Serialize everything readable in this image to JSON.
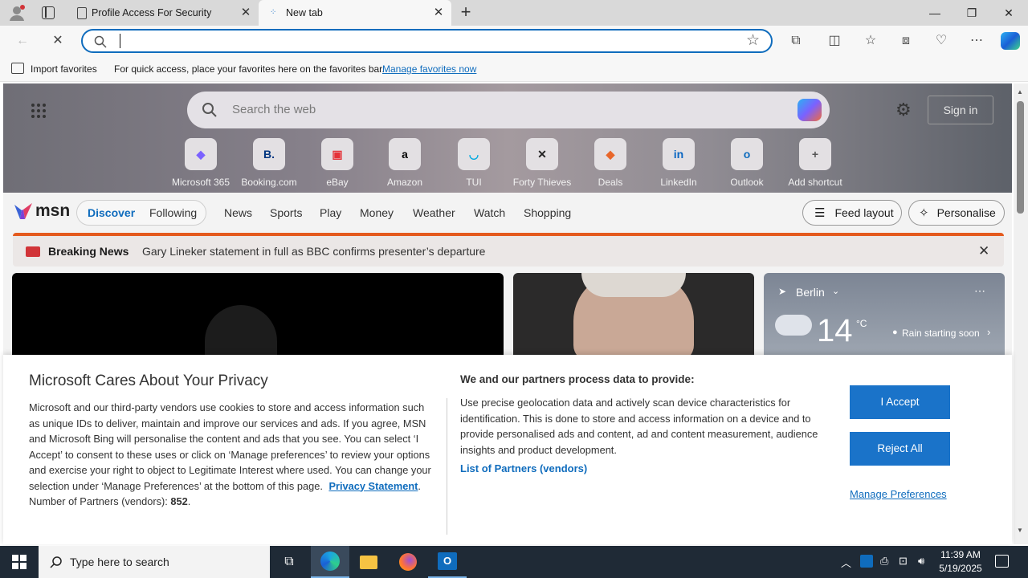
{
  "browser": {
    "tabs": [
      {
        "label": "Profile Access For Security",
        "active": false
      },
      {
        "label": "New tab",
        "active": true
      }
    ],
    "address_value": "",
    "favorites_bar": {
      "import_label": "Import favorites",
      "hint": "For quick access, place your favorites here on the favorites bar.",
      "manage_link": "Manage favorites now"
    }
  },
  "newtab": {
    "search_placeholder": "Search the web",
    "sign_in": "Sign in",
    "shortcuts": [
      {
        "label": "Microsoft 365",
        "glyph": "◆",
        "color": "#7b61ff"
      },
      {
        "label": "Booking.com",
        "glyph": "B.",
        "color": "#003580"
      },
      {
        "label": "eBay",
        "glyph": "▣",
        "color": "#e53238"
      },
      {
        "label": "Amazon",
        "glyph": "a",
        "color": "#000000"
      },
      {
        "label": "TUI",
        "glyph": "◡",
        "color": "#00a9e0"
      },
      {
        "label": "Forty Thieves",
        "glyph": "✕",
        "color": "#222222"
      },
      {
        "label": "Deals",
        "glyph": "◆",
        "color": "#e8662a"
      },
      {
        "label": "LinkedIn",
        "glyph": "in",
        "color": "#0a66c2"
      },
      {
        "label": "Outlook",
        "glyph": "o",
        "color": "#0f6cbd"
      },
      {
        "label": "Add shortcut",
        "glyph": "+",
        "color": "#555555"
      }
    ],
    "brand": "msn",
    "nav": {
      "discover": "Discover",
      "following": "Following",
      "items": [
        "News",
        "Sports",
        "Play",
        "Money",
        "Weather",
        "Watch",
        "Shopping"
      ],
      "feed_layout": "Feed layout",
      "personalise": "Personalise"
    },
    "breaking": {
      "label": "Breaking News",
      "headline": "Gary Lineker statement in full as BBC confirms presenter’s departure"
    },
    "weather": {
      "city": "Berlin",
      "temp": "14",
      "unit": "°C",
      "forecast": "Rain starting soon"
    }
  },
  "privacy": {
    "title": "Microsoft Cares About Your Privacy",
    "body": "Microsoft and our third-party vendors use cookies to store and access information such as unique IDs to deliver, maintain and improve our services and ads. If you agree, MSN and Microsoft Bing will personalise the content and ads that you see. You can select ‘I Accept’ to consent to these uses or click on ‘Manage preferences’ to review your options and exercise your right to object to Legitimate Interest where used.  You can change your selection under ‘Manage Preferences’ at the bottom of this page.",
    "privacy_link": "Privacy Statement",
    "partners_label": "Number of Partners (vendors):",
    "partners_count": "852",
    "right_title": "We and our partners process data to provide:",
    "right_body": "Use precise geolocation data and actively scan device characteristics for identification. This is done to store and access information on a device and to provide personalised ads and content, ad and content measurement, audience insights and product development.",
    "partners_link": "List of Partners (vendors)",
    "accept": "I Accept",
    "reject": "Reject All",
    "manage": "Manage Preferences"
  },
  "taskbar": {
    "search_placeholder": "Type here to search",
    "time": "11:39 AM",
    "date": "5/19/2025"
  },
  "colors": {
    "accent": "#0f6cbd",
    "breaking": "#e45a1e",
    "button": "#1a73c9",
    "taskbar": "#1f2a36"
  }
}
